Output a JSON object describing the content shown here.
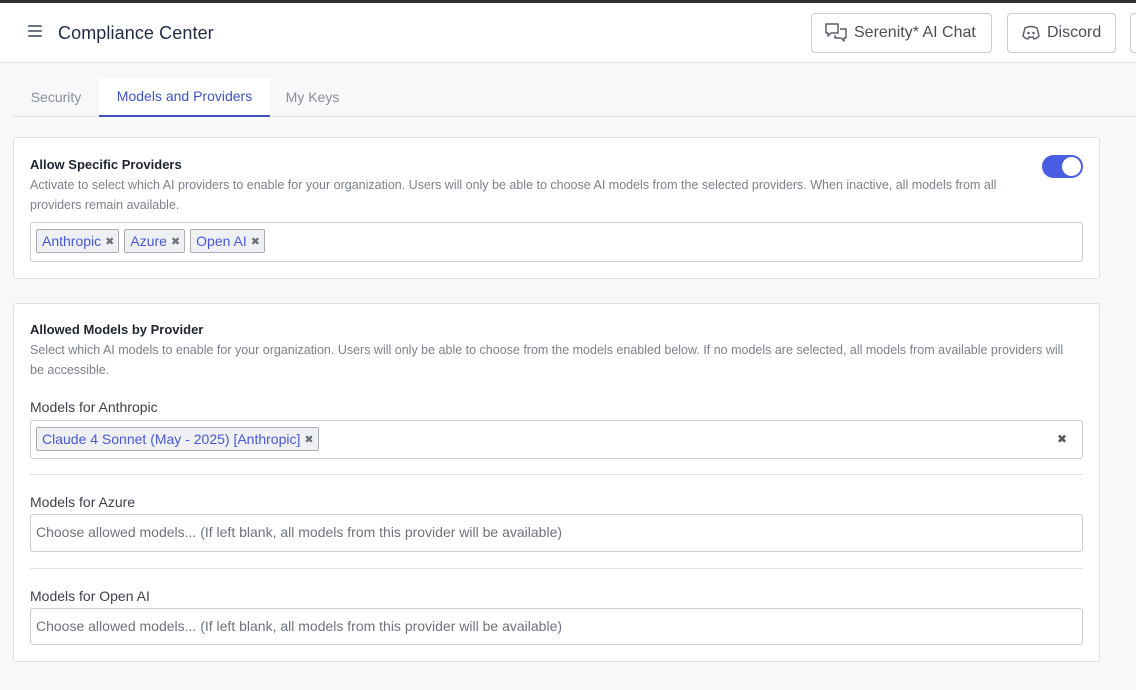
{
  "header": {
    "title": "Compliance Center",
    "chat_button": "Serenity* AI Chat",
    "discord_button": "Discord"
  },
  "tabs": [
    {
      "label": "Security",
      "active": false
    },
    {
      "label": "Models and Providers",
      "active": true
    },
    {
      "label": "My Keys",
      "active": false
    }
  ],
  "providers_card": {
    "title": "Allow Specific Providers",
    "description": "Activate to select which AI providers to enable for your organization. Users will only be able to choose AI models from the selected providers. When inactive, all models from all providers remain available.",
    "toggle_on": true,
    "selected": [
      "Anthropic",
      "Azure",
      "Open AI"
    ]
  },
  "models_card": {
    "title": "Allowed Models by Provider",
    "description": "Select which AI models to enable for your organization. Users will only be able to choose from the models enabled below. If no models are selected, all models from available providers will be accessible.",
    "anthropic": {
      "label": "Models for Anthropic",
      "selected": [
        "Claude 4 Sonnet (May - 2025) [Anthropic]"
      ]
    },
    "azure": {
      "label": "Models for Azure",
      "placeholder": "Choose allowed models... (If left blank, all models from this provider will be available)"
    },
    "openai": {
      "label": "Models for Open AI",
      "placeholder": "Choose allowed models... (If left blank, all models from this provider will be available)"
    }
  },
  "colors": {
    "accent": "#3f51c8",
    "toggle": "#4a5ee4",
    "chip_text": "#4a56d8"
  },
  "icons": [
    "hamburger-icon",
    "chat-icon",
    "discord-icon",
    "remove-icon",
    "clear-icon"
  ]
}
